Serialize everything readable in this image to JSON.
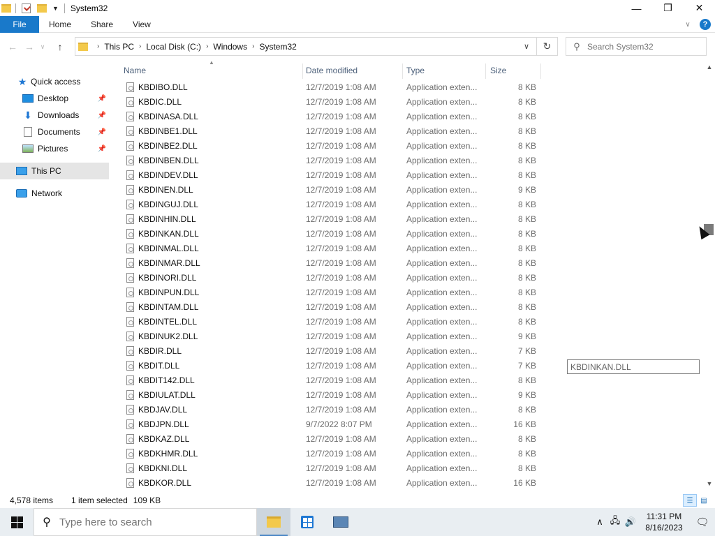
{
  "window": {
    "title": "System32",
    "minimize_icon": "—",
    "maximize_icon": "❐",
    "close_icon": "✕"
  },
  "ribbon": {
    "tabs": [
      "File",
      "Home",
      "Share",
      "View"
    ],
    "collapse_icon": "∨",
    "help_icon": "?"
  },
  "address": {
    "crumbs": [
      "This PC",
      "Local Disk (C:)",
      "Windows",
      "System32"
    ],
    "search_placeholder": "Search System32"
  },
  "nav_pane": {
    "items": [
      {
        "label": "Quick access",
        "icon": "star-icon"
      },
      {
        "label": "Desktop",
        "icon": "desktop-icon",
        "pinned": true
      },
      {
        "label": "Downloads",
        "icon": "downloads-icon",
        "pinned": true
      },
      {
        "label": "Documents",
        "icon": "documents-icon",
        "pinned": true
      },
      {
        "label": "Pictures",
        "icon": "pictures-icon",
        "pinned": true
      },
      {
        "label": "This PC",
        "icon": "this-pc-icon",
        "selected": true
      },
      {
        "label": "Network",
        "icon": "network-icon"
      }
    ]
  },
  "columns": {
    "name": "Name",
    "date": "Date modified",
    "type": "Type",
    "size": "Size"
  },
  "files": [
    {
      "name": "KBDIBO.DLL",
      "date": "12/7/2019 1:08 AM",
      "type": "Application exten...",
      "size": "8 KB"
    },
    {
      "name": "KBDIC.DLL",
      "date": "12/7/2019 1:08 AM",
      "type": "Application exten...",
      "size": "8 KB"
    },
    {
      "name": "KBDINASA.DLL",
      "date": "12/7/2019 1:08 AM",
      "type": "Application exten...",
      "size": "8 KB"
    },
    {
      "name": "KBDINBE1.DLL",
      "date": "12/7/2019 1:08 AM",
      "type": "Application exten...",
      "size": "8 KB"
    },
    {
      "name": "KBDINBE2.DLL",
      "date": "12/7/2019 1:08 AM",
      "type": "Application exten...",
      "size": "8 KB"
    },
    {
      "name": "KBDINBEN.DLL",
      "date": "12/7/2019 1:08 AM",
      "type": "Application exten...",
      "size": "8 KB"
    },
    {
      "name": "KBDINDEV.DLL",
      "date": "12/7/2019 1:08 AM",
      "type": "Application exten...",
      "size": "8 KB"
    },
    {
      "name": "KBDINEN.DLL",
      "date": "12/7/2019 1:08 AM",
      "type": "Application exten...",
      "size": "9 KB"
    },
    {
      "name": "KBDINGUJ.DLL",
      "date": "12/7/2019 1:08 AM",
      "type": "Application exten...",
      "size": "8 KB"
    },
    {
      "name": "KBDINHIN.DLL",
      "date": "12/7/2019 1:08 AM",
      "type": "Application exten...",
      "size": "8 KB"
    },
    {
      "name": "KBDINKAN.DLL",
      "date": "12/7/2019 1:08 AM",
      "type": "Application exten...",
      "size": "8 KB"
    },
    {
      "name": "KBDINMAL.DLL",
      "date": "12/7/2019 1:08 AM",
      "type": "Application exten...",
      "size": "8 KB"
    },
    {
      "name": "KBDINMAR.DLL",
      "date": "12/7/2019 1:08 AM",
      "type": "Application exten...",
      "size": "8 KB"
    },
    {
      "name": "KBDINORI.DLL",
      "date": "12/7/2019 1:08 AM",
      "type": "Application exten...",
      "size": "8 KB"
    },
    {
      "name": "KBDINPUN.DLL",
      "date": "12/7/2019 1:08 AM",
      "type": "Application exten...",
      "size": "8 KB"
    },
    {
      "name": "KBDINTAM.DLL",
      "date": "12/7/2019 1:08 AM",
      "type": "Application exten...",
      "size": "8 KB"
    },
    {
      "name": "KBDINTEL.DLL",
      "date": "12/7/2019 1:08 AM",
      "type": "Application exten...",
      "size": "8 KB"
    },
    {
      "name": "KBDINUK2.DLL",
      "date": "12/7/2019 1:08 AM",
      "type": "Application exten...",
      "size": "9 KB"
    },
    {
      "name": "KBDIR.DLL",
      "date": "12/7/2019 1:08 AM",
      "type": "Application exten...",
      "size": "7 KB"
    },
    {
      "name": "KBDIT.DLL",
      "date": "12/7/2019 1:08 AM",
      "type": "Application exten...",
      "size": "7 KB"
    },
    {
      "name": "KBDIT142.DLL",
      "date": "12/7/2019 1:08 AM",
      "type": "Application exten...",
      "size": "8 KB"
    },
    {
      "name": "KBDIULAT.DLL",
      "date": "12/7/2019 1:08 AM",
      "type": "Application exten...",
      "size": "9 KB"
    },
    {
      "name": "KBDJAV.DLL",
      "date": "12/7/2019 1:08 AM",
      "type": "Application exten...",
      "size": "8 KB"
    },
    {
      "name": "KBDJPN.DLL",
      "date": "9/7/2022 8:07 PM",
      "type": "Application exten...",
      "size": "16 KB"
    },
    {
      "name": "KBDKAZ.DLL",
      "date": "12/7/2019 1:08 AM",
      "type": "Application exten...",
      "size": "8 KB"
    },
    {
      "name": "KBDKHMR.DLL",
      "date": "12/7/2019 1:08 AM",
      "type": "Application exten...",
      "size": "8 KB"
    },
    {
      "name": "KBDKNI.DLL",
      "date": "12/7/2019 1:08 AM",
      "type": "Application exten...",
      "size": "8 KB"
    },
    {
      "name": "KBDKOR.DLL",
      "date": "12/7/2019 1:08 AM",
      "type": "Application exten...",
      "size": "16 KB"
    }
  ],
  "rename_box": {
    "value": "KBDINKAN.DLL"
  },
  "status": {
    "count": "4,578 items",
    "selected": "1 item selected",
    "size": "109 KB"
  },
  "taskbar": {
    "search_placeholder": "Type here to search",
    "time": "11:31 PM",
    "date": "8/16/2023"
  },
  "colors": {
    "accent": "#1979ca",
    "selection": "#e5e5e5",
    "header_text": "#4c607a"
  }
}
